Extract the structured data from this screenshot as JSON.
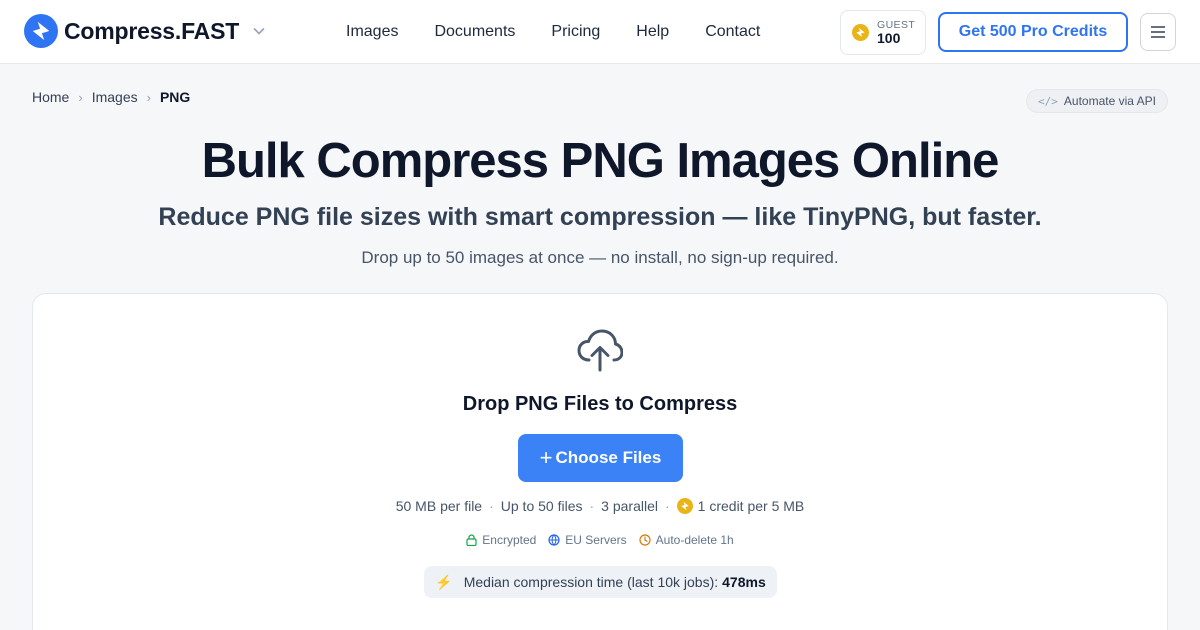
{
  "brand": {
    "name": "Compress.FAST",
    "accent": "#2f74f2",
    "coin_color": "#e8b417"
  },
  "nav": {
    "items": [
      {
        "label": "Images"
      },
      {
        "label": "Documents"
      },
      {
        "label": "Pricing"
      },
      {
        "label": "Help"
      },
      {
        "label": "Contact"
      }
    ]
  },
  "credits": {
    "label": "GUEST",
    "value": "100"
  },
  "cta": {
    "label": "Get 500 Pro Credits"
  },
  "breadcrumb": {
    "items": [
      "Home",
      "Images",
      "PNG"
    ],
    "separator": "›"
  },
  "api_link": {
    "icon": "code-icon",
    "label": "Automate via API"
  },
  "hero": {
    "title": "Bulk Compress PNG Images Online",
    "subtitle": "Reduce PNG file sizes with smart compression — like TinyPNG, but faster.",
    "note": "Drop up to 50 images at once — no install, no sign-up required."
  },
  "dropzone": {
    "icon": "cloud-upload-icon",
    "title": "Drop PNG Files to Compress",
    "button_label": "Choose Files",
    "limits": [
      "50 MB per file",
      "Up to 50 files",
      "3 parallel",
      "1 credit per 5 MB"
    ],
    "security": [
      {
        "icon": "lock-icon",
        "label": "Encrypted",
        "color": "#16a34a"
      },
      {
        "icon": "globe-icon",
        "label": "EU Servers",
        "color": "#2563eb"
      },
      {
        "icon": "clock-icon",
        "label": "Auto-delete 1h",
        "color": "#d97706"
      }
    ],
    "median": {
      "label": "Median compression time (last 10k jobs):",
      "value": "478ms"
    }
  }
}
